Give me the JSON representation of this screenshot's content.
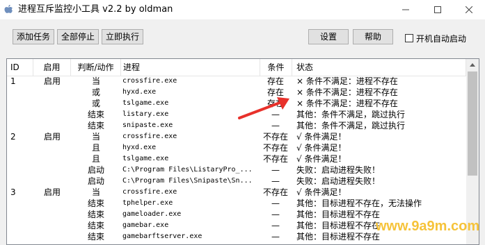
{
  "window": {
    "title": "进程互斥监控小工具 v2.2 by oldman",
    "icon": "apple-logo-icon",
    "controls": {
      "minimize": "—",
      "maximize": "☐",
      "close": "✕"
    }
  },
  "toolbar": {
    "add_task": "添加任务",
    "stop_all": "全部停止",
    "execute_now": "立即执行",
    "settings": "设置",
    "help": "帮助",
    "autostart_label": "开机自动启动",
    "autostart_checked": false
  },
  "table": {
    "columns": [
      "ID",
      "启用",
      "判断/动作",
      "进程",
      "条件",
      "状态"
    ],
    "rows": [
      {
        "id": "1",
        "enabled": "启用",
        "judge": "当",
        "process": "crossfire.exe",
        "condition": "存在",
        "status": "× 条件不满足：进程不存在"
      },
      {
        "id": "",
        "enabled": "",
        "judge": "或",
        "process": "hyxd.exe",
        "condition": "存在",
        "status": "× 条件不满足：进程不存在"
      },
      {
        "id": "",
        "enabled": "",
        "judge": "或",
        "process": "tslgame.exe",
        "condition": "存在",
        "status": "× 条件不满足：进程不存在"
      },
      {
        "id": "",
        "enabled": "",
        "judge": "结束",
        "process": "listary.exe",
        "condition": "—",
        "status": "其他：条件不满足，跳过执行"
      },
      {
        "id": "",
        "enabled": "",
        "judge": "结束",
        "process": "snipaste.exe",
        "condition": "—",
        "status": "其他：条件不满足，跳过执行"
      },
      {
        "id": "2",
        "enabled": "启用",
        "judge": "当",
        "process": "crossfire.exe",
        "condition": "不存在",
        "status": "√ 条件满足！"
      },
      {
        "id": "",
        "enabled": "",
        "judge": "且",
        "process": "hyxd.exe",
        "condition": "不存在",
        "status": "√ 条件满足！"
      },
      {
        "id": "",
        "enabled": "",
        "judge": "且",
        "process": "tslgame.exe",
        "condition": "不存在",
        "status": "√ 条件满足！"
      },
      {
        "id": "",
        "enabled": "",
        "judge": "启动",
        "process": "C:\\Program Files\\ListaryPro_...",
        "condition": "—",
        "status": "失败：启动进程失败！"
      },
      {
        "id": "",
        "enabled": "",
        "judge": "启动",
        "process": "C:\\Program Files\\Snipaste\\Sn...",
        "condition": "—",
        "status": "失败：启动进程失败！"
      },
      {
        "id": "3",
        "enabled": "启用",
        "judge": "当",
        "process": "crossfire.exe",
        "condition": "不存在",
        "status": "√ 条件满足！"
      },
      {
        "id": "",
        "enabled": "",
        "judge": "结束",
        "process": "tphelper.exe",
        "condition": "—",
        "status": "其他：目标进程不存在，无法操作"
      },
      {
        "id": "",
        "enabled": "",
        "judge": "结束",
        "process": "gameloader.exe",
        "condition": "—",
        "status": "其他：目标进程不存在"
      },
      {
        "id": "",
        "enabled": "",
        "judge": "结束",
        "process": "gamebar.exe",
        "condition": "—",
        "status": "其他：目标进程不存在"
      },
      {
        "id": "",
        "enabled": "",
        "judge": "结束",
        "process": "gamebarftserver.exe",
        "condition": "—",
        "status": "其他：目标进程不存在"
      }
    ]
  },
  "annotation": {
    "arrow_color": "#e8312b",
    "icon": "red-arrow-icon"
  },
  "watermark": {
    "text": "www.9a9m.com",
    "color": "#f6c33a"
  }
}
